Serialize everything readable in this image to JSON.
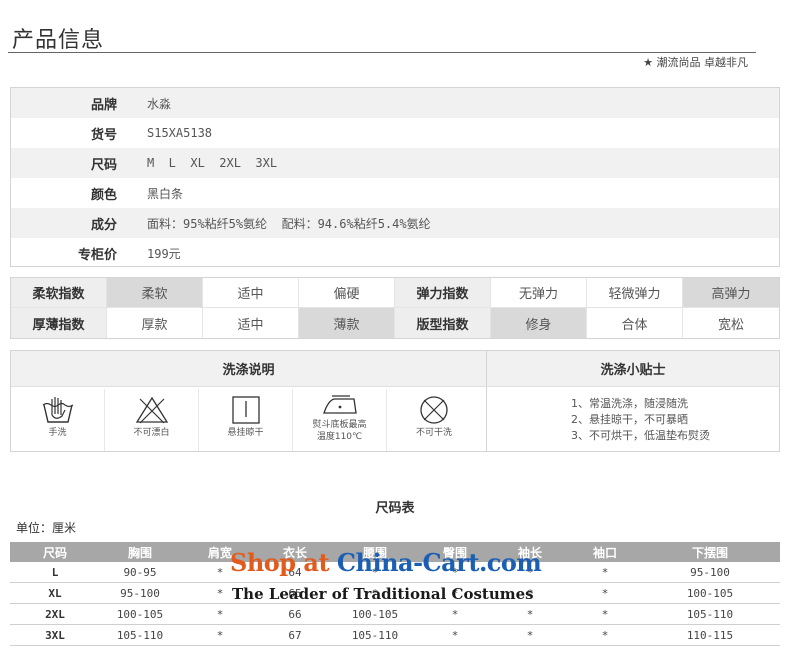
{
  "header": {
    "title": "产品信息",
    "slogan": "★ 潮流尚品 卓越非凡"
  },
  "info": [
    {
      "label": "品牌",
      "value": "水淼"
    },
    {
      "label": "货号",
      "value": "S15XA5138"
    },
    {
      "label": "尺码",
      "value": "M  L  XL  2XL  3XL"
    },
    {
      "label": "颜色",
      "value": "黑白条"
    },
    {
      "label": "成分",
      "value": "面料：95%粘纤5%氨纶  配料：94.6%粘纤5.4%氨纶"
    },
    {
      "label": "专柜价",
      "value": "199元"
    }
  ],
  "attributes": {
    "row1": {
      "label1": "柔软指数",
      "opts1": [
        "柔软",
        "适中",
        "偏硬"
      ],
      "label2": "弹力指数",
      "opts2": [
        "无弹力",
        "轻微弹力",
        "高弹力"
      ]
    },
    "row2": {
      "label1": "厚薄指数",
      "opts1": [
        "厚款",
        "适中",
        "薄款"
      ],
      "label2": "版型指数",
      "opts2": [
        "修身",
        "合体",
        "宽松"
      ]
    },
    "selected": {
      "softness": "柔软",
      "elasticity": "高弹力",
      "thickness": "薄款",
      "fit": "修身"
    }
  },
  "wash": {
    "instructions_title": "洗涤说明",
    "tips_title": "洗涤小贴士",
    "icons": [
      {
        "icon": "hand-wash-icon",
        "caption": "手洗"
      },
      {
        "icon": "no-bleach-icon",
        "caption": "不可漂白"
      },
      {
        "icon": "hang-dry-icon",
        "caption": "悬挂晾干"
      },
      {
        "icon": "iron-icon",
        "caption": "熨斗底板最高",
        "caption2": "温度110℃"
      },
      {
        "icon": "no-dry-clean-icon",
        "caption": "不可干洗"
      }
    ],
    "tips": [
      "1、常温洗涤，随浸随洗",
      "2、悬挂晾干，不可暴晒",
      "3、不可烘干，低温垫布熨烫"
    ]
  },
  "size_chart": {
    "title": "尺码表",
    "unit": "单位：厘米",
    "headers": [
      "尺码",
      "胸围",
      "肩宽",
      "衣长",
      "腰围",
      "臀围",
      "袖长",
      "袖口",
      "下摆围"
    ],
    "rows": [
      [
        "L",
        "90-95",
        "*",
        "64",
        "*",
        "*",
        "*",
        "*",
        "95-100"
      ],
      [
        "XL",
        "95-100",
        "*",
        "65",
        "*",
        "*",
        "*",
        "*",
        "100-105"
      ],
      [
        "2XL",
        "100-105",
        "*",
        "66",
        "100-105",
        "*",
        "*",
        "*",
        "105-110"
      ],
      [
        "3XL",
        "105-110",
        "*",
        "67",
        "105-110",
        "*",
        "*",
        "*",
        "110-115"
      ]
    ]
  },
  "watermark": {
    "main_a": "Shop at ",
    "main_b": "China-Cart",
    "main_c": ".com",
    "sub": "The Leader of Traditional Costumes"
  }
}
